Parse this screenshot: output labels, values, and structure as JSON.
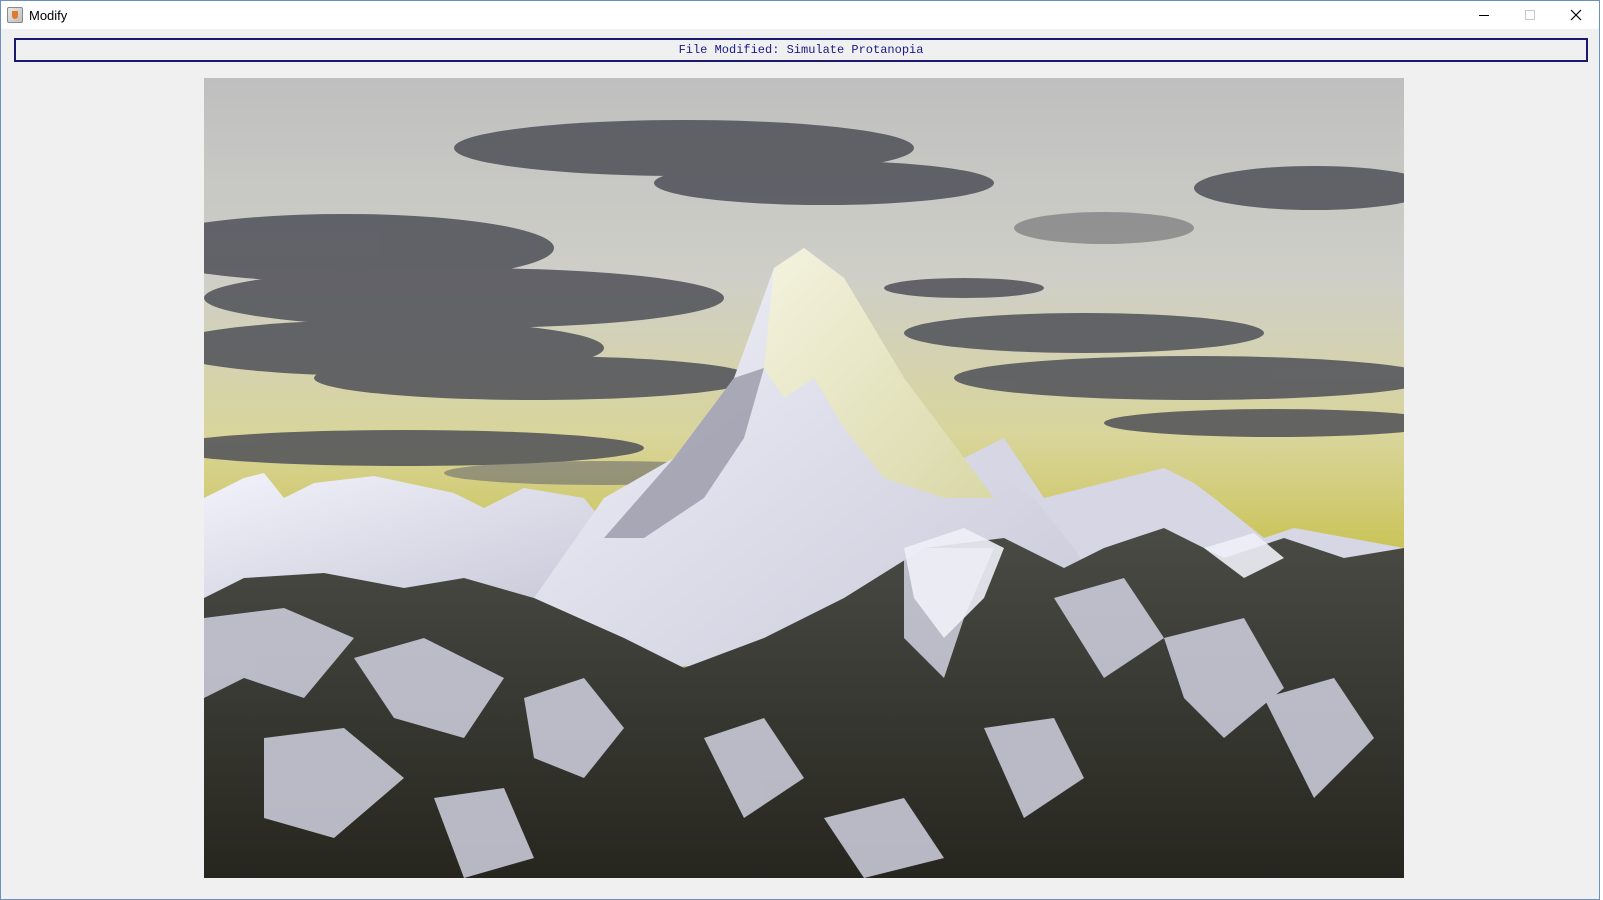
{
  "window": {
    "title": "Modify",
    "controls": {
      "minimize": "minimize-icon",
      "maximize": "maximize-icon",
      "close": "close-icon"
    }
  },
  "status": {
    "text": "File Modified: Simulate Protanopia",
    "border_color": "#1a1a6e",
    "text_color": "#1a1a8a"
  },
  "image": {
    "subject": "snow-capped mountain peak under cloudy yellow-tinted sky",
    "palette": {
      "sky_top": "#c9c9c9",
      "sky_horizon": "#d8d06a",
      "cloud": "#55555e",
      "snow": "#e8e8f4",
      "rock": "#2e2f2a"
    }
  }
}
